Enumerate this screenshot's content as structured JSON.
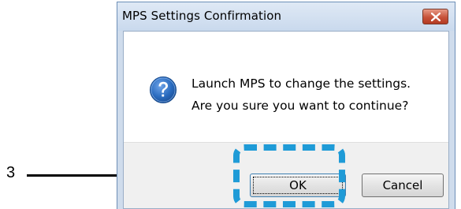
{
  "callout": {
    "number": "3"
  },
  "dialog": {
    "title": "MPS Settings Confirmation",
    "icon": "question-icon",
    "message_line1": "Launch MPS to change the settings.",
    "message_line2": "Are you sure you want to continue?",
    "ok_label": "OK",
    "cancel_label": "Cancel"
  },
  "colors": {
    "highlight": "#1f9bd7",
    "close_button": "#c7533a",
    "question_icon": "#1f5fae",
    "titlebar": "#c9d9ed"
  }
}
